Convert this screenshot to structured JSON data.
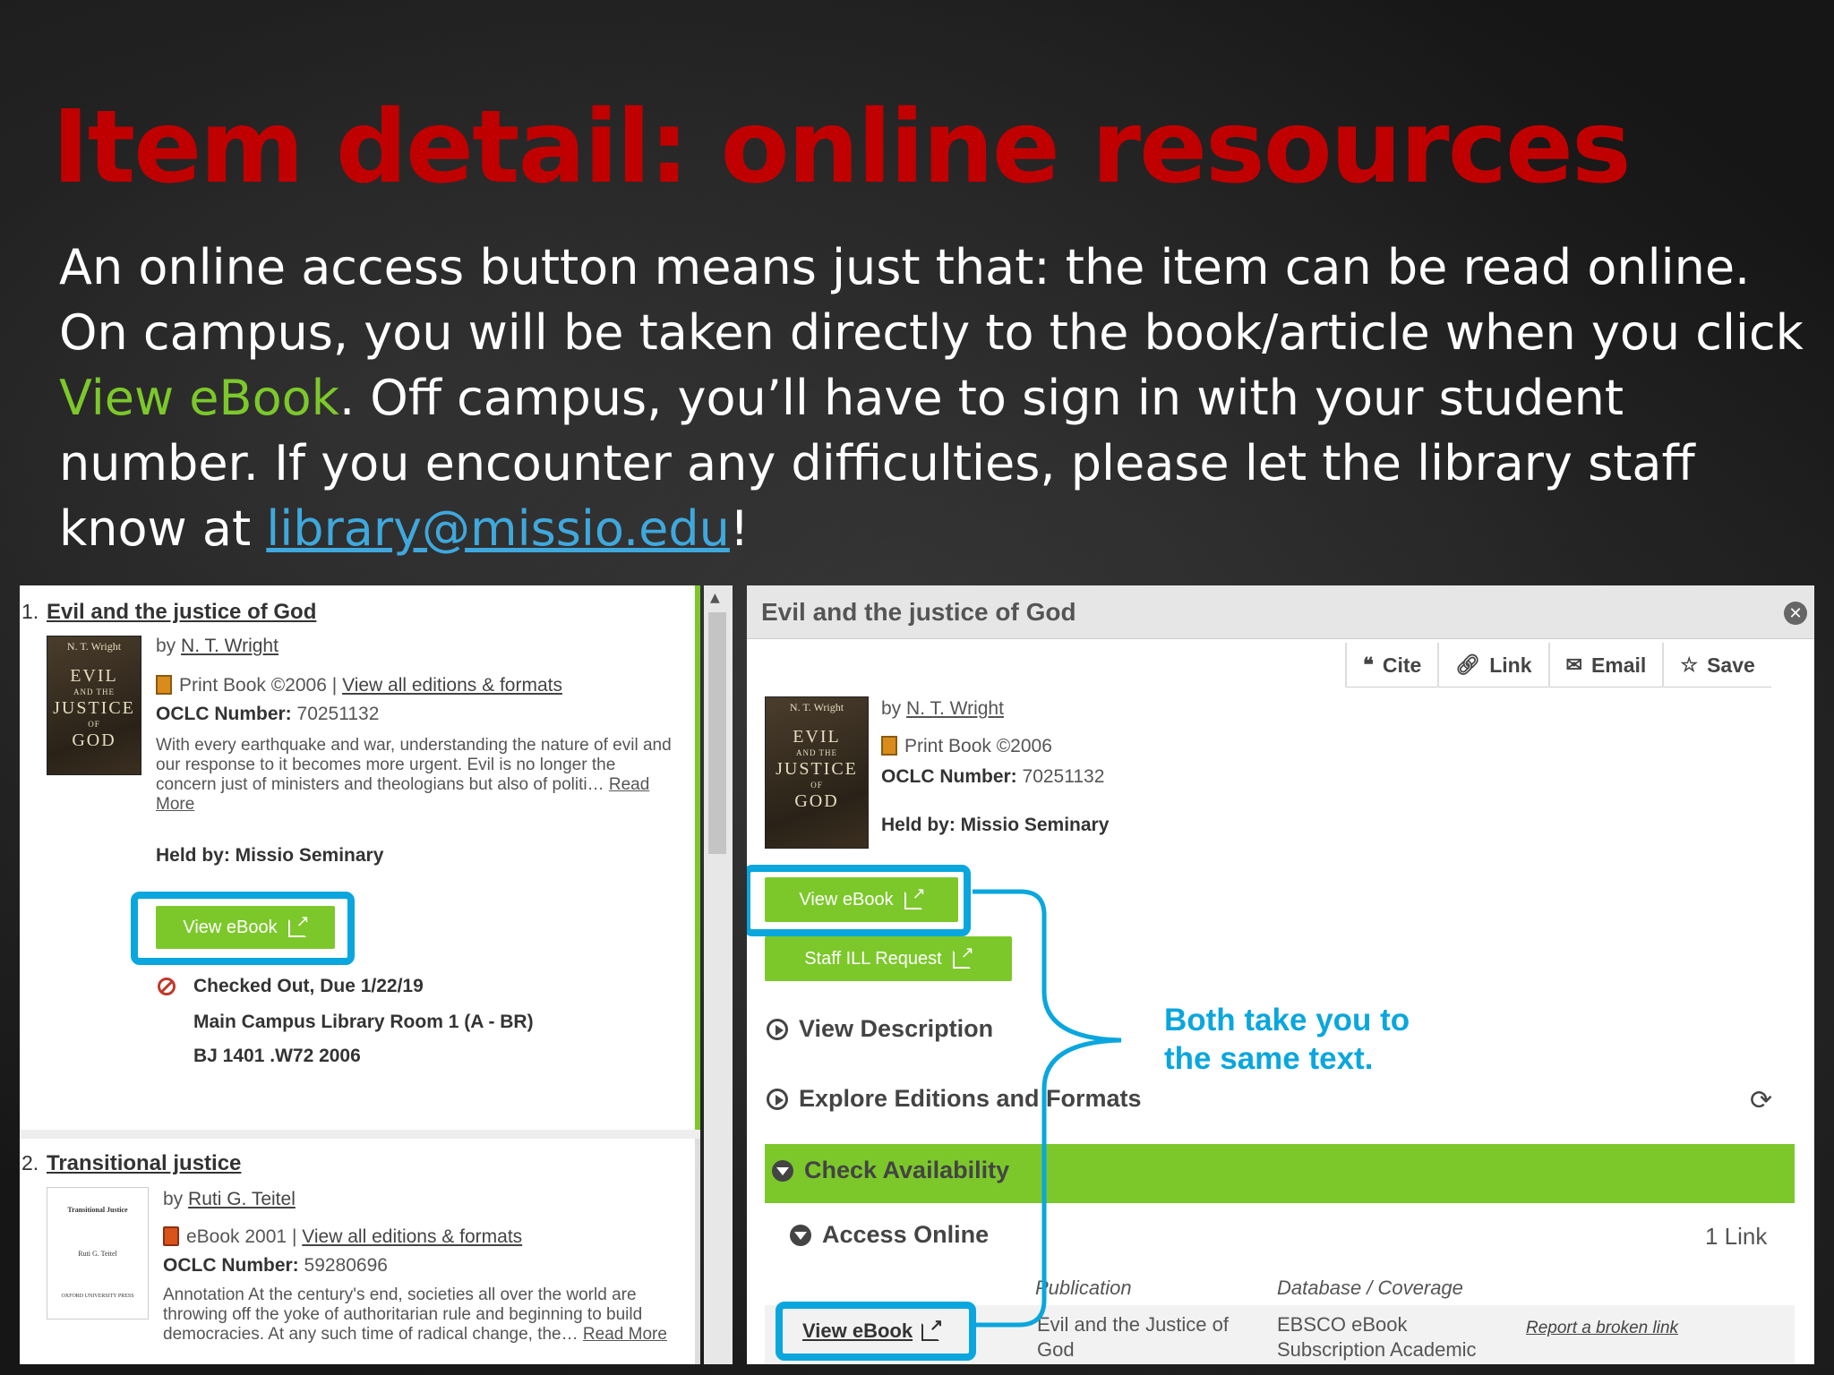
{
  "slide": {
    "title": "Item detail: online resources",
    "body_1": "An online access button means just that: the item can be read online. On campus, you will be taken directly to the book/article when you click ",
    "body_highlight": "View eBook",
    "body_2": ". Off campus, you’ll have to sign in with your student number. If you encounter any difficulties, please let the library staff know at ",
    "email": "library@missio.edu",
    "body_3": "!"
  },
  "results": [
    {
      "number": "1.",
      "title": "Evil and the justice of God",
      "by_prefix": "by",
      "author": "N. T. Wright",
      "format": "Print Book ©2006",
      "sep": "|",
      "editions_link": "View all editions & formats",
      "oclc_label": "OCLC Number:",
      "oclc": "70251132",
      "description": "With every earthquake and war, understanding the nature of evil and our response to it becomes more urgent. Evil is no longer the concern just of ministers and theologians but also of politi…",
      "read_more": "Read More",
      "held_by": "Held by: Missio Seminary",
      "button": "View eBook",
      "status": "Checked Out, Due 1/22/19",
      "location": "Main Campus Library Room 1 (A - BR)",
      "call_number": "BJ 1401 .W72 2006",
      "cover": {
        "author": "N. T. Wright",
        "line1": "EVIL",
        "small1": "AND THE",
        "line2": "JUSTICE",
        "small2": "OF",
        "line3": "GOD"
      }
    },
    {
      "number": "2.",
      "title": "Transitional justice",
      "by_prefix": "by",
      "author": "Ruti G. Teitel",
      "format": "eBook 2001",
      "sep": "|",
      "editions_link": "View all editions & formats",
      "oclc_label": "OCLC Number:",
      "oclc": "59280696",
      "description": "Annotation At the century's end, societies all over the world are throwing off the yoke of authoritarian rule and beginning to build democracies. At any such time of radical change, the…",
      "read_more": "Read More",
      "cover": {
        "title": "Transitional Justice",
        "author": "Ruti G. Teitel",
        "publisher": "OXFORD UNIVERSITY PRESS"
      }
    }
  ],
  "detail": {
    "title": "Evil and the justice of God",
    "toolbar": {
      "cite": "Cite",
      "link": "Link",
      "email": "Email",
      "save": "Save"
    },
    "by_prefix": "by",
    "author": "N. T. Wright",
    "format": "Print Book ©2006",
    "oclc_label": "OCLC Number:",
    "oclc": "70251132",
    "held_by": "Held by: Missio Seminary",
    "view_ebook": "View eBook",
    "staff_ill": "Staff ILL Request",
    "view_description": "View Description",
    "explore_editions": "Explore Editions and Formats",
    "check_availability": "Check Availability",
    "access_online": "Access Online",
    "link_count": "1 Link",
    "col_publication": "Publication",
    "col_database": "Database / Coverage",
    "row_button": "View eBook",
    "row_publication": "Evil and the Justice of God",
    "row_database": "EBSCO eBook Subscription Academic",
    "report_link": "Report a broken link"
  },
  "annotation": {
    "line1": "Both take you to",
    "line2": "the same text."
  },
  "colors": {
    "title_red": "#c00000",
    "accent_green": "#7cc82b",
    "callout_blue": "#0aa6de",
    "link_blue": "#3fa8dc"
  }
}
